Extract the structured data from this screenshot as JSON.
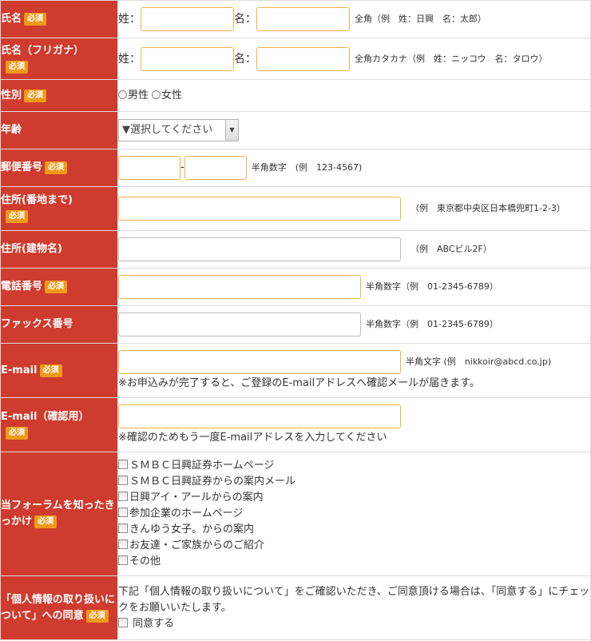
{
  "required_badge": "必須",
  "rows": {
    "name": {
      "label": "氏名",
      "sei": "姓：",
      "mei": "名：",
      "hint": "全角（例　姓：日興　名：太郎）"
    },
    "kana": {
      "label": "氏名（フリガナ）",
      "sei": "姓：",
      "mei": "名：",
      "hint": "全角カタカナ（例　姓：ニッコウ　名：タロウ）"
    },
    "gender": {
      "label": "性別",
      "male": "男性",
      "female": "女性"
    },
    "age": {
      "label": "年齢",
      "select_value": "▼選択してください",
      "arrow": "▼"
    },
    "zip": {
      "label": "郵便番号",
      "sep": "-",
      "hint": "半角数字　(例　123-4567)"
    },
    "address1": {
      "label": "住所(番地まで)",
      "hint": "（例　東京都中央区日本橋兜町1-2-3）"
    },
    "address2": {
      "label": "住所(建物名)",
      "hint": "（例　ABCビル2F）"
    },
    "tel": {
      "label": "電話番号",
      "hint": "半角数字（例　01-2345-6789）"
    },
    "fax": {
      "label": "ファックス番号",
      "hint": "半角数字（例　01-2345-6789）"
    },
    "email": {
      "label": "E-mail",
      "hint": "半角文字 (例　nikkoir@abcd.co.jp)",
      "note": "※お申込みが完了すると、ご登録のE-mailアドレスへ確認メールが届きます。"
    },
    "email_confirm": {
      "label": "E-mail（確認用）",
      "note": "※確認のためもう一度E-mailアドレスを入力してください"
    },
    "source": {
      "label": "当フォーラムを知ったきっかけ",
      "options": [
        "ＳＭＢＣ日興証券ホームページ",
        "ＳＭＢＣ日興証券からの案内メール",
        "日興アイ・アールからの案内",
        "参加企業のホームページ",
        "きんゆう女子。からの案内",
        "お友達・ご家族からのご紹介",
        "その他"
      ]
    },
    "privacy": {
      "label": "「個人情報の取り扱いについて」への同意",
      "text": "下記「個人情報の取り扱いについて」をご確認いただき、ご同意頂ける場合は、「同意する」にチェックをお願いいたします。",
      "agree": "同意する"
    }
  }
}
